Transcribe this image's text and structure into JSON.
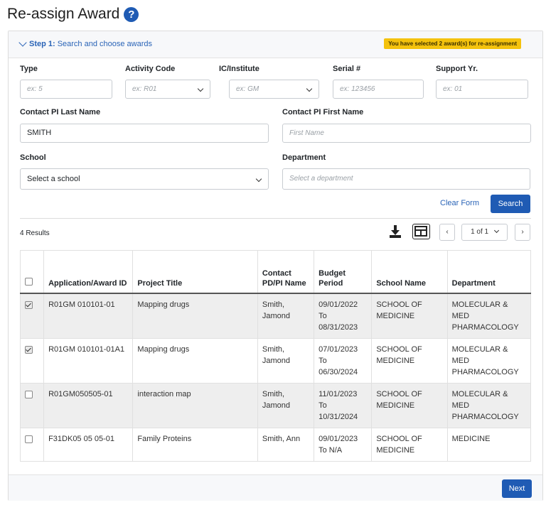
{
  "page": {
    "title": "Re-assign Award"
  },
  "step": {
    "label": "Step 1:",
    "text": "Search and choose awards",
    "selected_badge": "You have selected 2 award(s) for re-assignment"
  },
  "form": {
    "type": {
      "label": "Type",
      "placeholder": "ex: 5"
    },
    "activity_code": {
      "label": "Activity Code",
      "placeholder": "ex: R01"
    },
    "ic": {
      "label": "IC/Institute",
      "placeholder": "ex: GM"
    },
    "serial": {
      "label": "Serial #",
      "placeholder": "ex: 123456"
    },
    "support_yr": {
      "label": "Support Yr.",
      "placeholder": "ex: 01"
    },
    "pi_last": {
      "label": "Contact PI Last Name",
      "value": "SMITH"
    },
    "pi_first": {
      "label": "Contact PI First Name",
      "placeholder": "First Name"
    },
    "school": {
      "label": "School",
      "placeholder": "Select a school"
    },
    "department": {
      "label": "Department",
      "placeholder": "Select a department"
    },
    "clear_label": "Clear Form",
    "search_label": "Search"
  },
  "results": {
    "count_text": "4 Results",
    "pagination": {
      "page_text": "1 of 1",
      "prev": "‹",
      "next": "›"
    }
  },
  "table": {
    "headers": {
      "app_id": "Application/Award ID",
      "project": "Project Title",
      "contact": "Contact PD/PI Name",
      "budget": "Budget Period",
      "school": "School Name",
      "dept": "Department"
    },
    "rows": [
      {
        "checked": true,
        "app_id": "R01GM 010101-01",
        "project": "Mapping drugs",
        "contact": "Smith, Jamond",
        "budget": "09/01/2022 To 08/31/2023",
        "school": "SCHOOL OF MEDICINE",
        "dept": "MOLECULAR & MED PHARMACOLOGY"
      },
      {
        "checked": true,
        "app_id": "R01GM 010101-01A1",
        "project": "Mapping drugs",
        "contact": "Smith, Jamond",
        "budget": "07/01/2023 To 06/30/2024",
        "school": "SCHOOL OF MEDICINE",
        "dept": "MOLECULAR & MED PHARMACOLOGY"
      },
      {
        "checked": false,
        "app_id": "R01GM050505-01",
        "project": "interaction map",
        "contact": "Smith, Jamond",
        "budget": "11/01/2023 To 10/31/2024",
        "school": "SCHOOL OF MEDICINE",
        "dept": "MOLECULAR & MED PHARMACOLOGY"
      },
      {
        "checked": false,
        "app_id": "F31DK05 05 05-01",
        "project": "Family Proteins",
        "contact": "Smith, Ann",
        "budget": "09/01/2023 To N/A",
        "school": "SCHOOL OF MEDICINE",
        "dept": "MEDICINE"
      }
    ]
  },
  "footer": {
    "next_label": "Next"
  },
  "colors": {
    "primary": "#1f5bb4",
    "badge": "#f4c20d"
  }
}
